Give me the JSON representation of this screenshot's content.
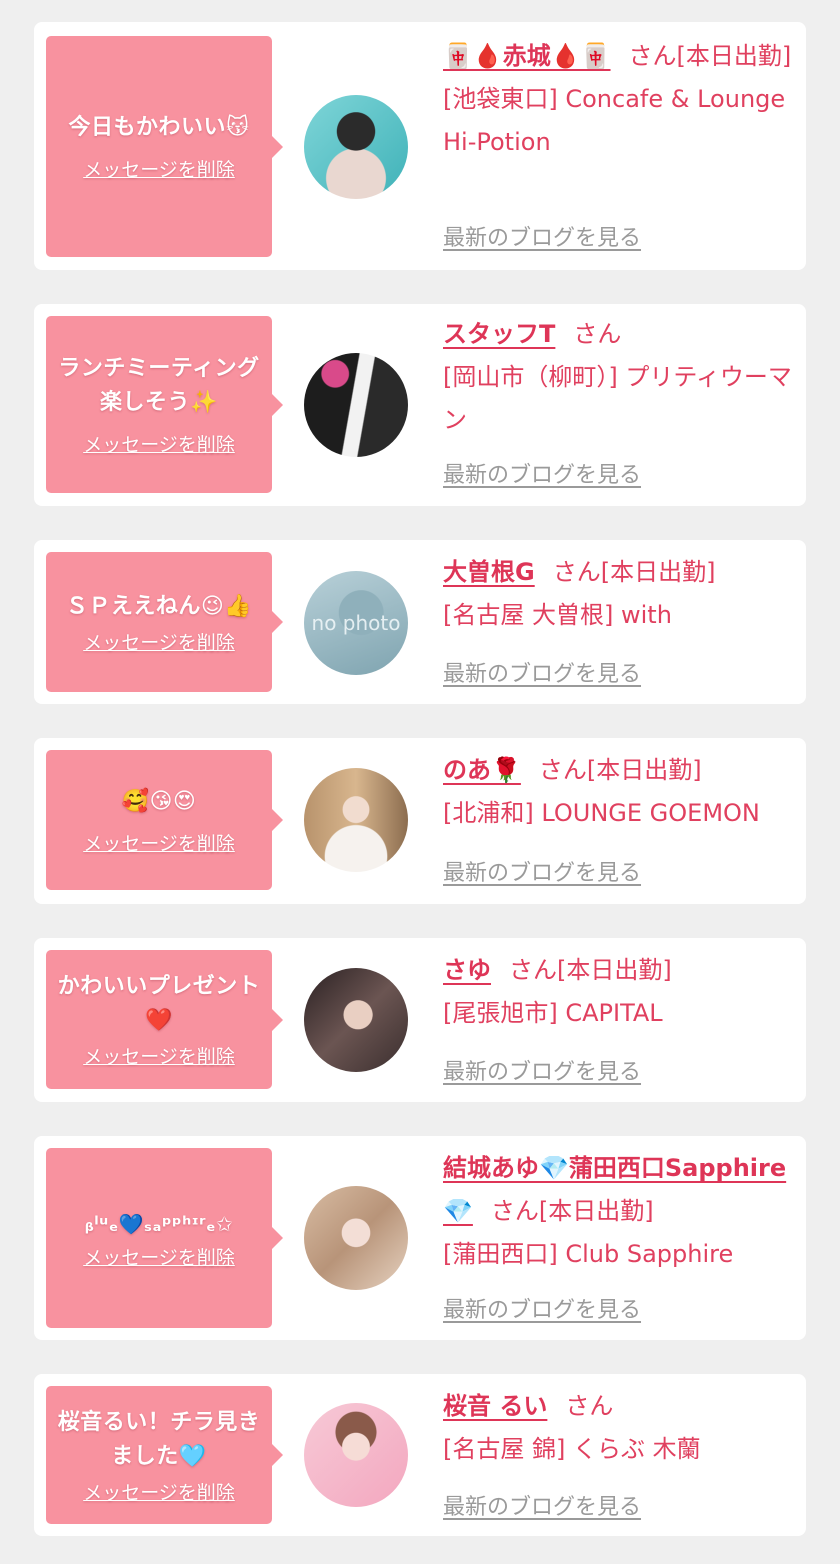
{
  "delete_label": "メッセージを削除",
  "blog_label": "最新のブログを見る",
  "san_label": "さん",
  "colors": {
    "bubble": "#f8929f",
    "accent": "#de3557",
    "link_gray": "#9a9a9a",
    "background": "#efefef"
  },
  "items": [
    {
      "message": "今日もかわいい😽",
      "name": "🀄🩸赤城🩸🀄",
      "status": "[本日出勤]",
      "shop": "[池袋東口] Concafe & Lounge Hi-Potion",
      "avatar": "person-photo"
    },
    {
      "message": "ランチミーティング楽しそう✨",
      "name": "スタッフT",
      "status": "",
      "shop": "[岡山市（柳町）] プリティウーマン",
      "avatar": "shop-logo"
    },
    {
      "message": "ＳＰええねん😉👍",
      "name": "大曽根G",
      "status": "[本日出勤]",
      "shop": "[名古屋 大曽根] with",
      "avatar": "no-photo",
      "avatar_text": "no photo"
    },
    {
      "message": "🥰😘😍",
      "name": "のあ🌹",
      "status": "[本日出勤]",
      "shop": "[北浦和] LOUNGE GOEMON",
      "avatar": "person-photo"
    },
    {
      "message": "かわいいプレゼント❤️",
      "name": "さゆ",
      "status": "[本日出勤]",
      "shop": "[尾張旭市] CAPITAL",
      "avatar": "person-photo"
    },
    {
      "message": "ᵦˡᵘₑ💙ₛₐᵖᵖʰᶦʳₑ✩",
      "name": "結城あゆ💎蒲田西口Sapphire💎",
      "status": "[本日出勤]",
      "shop": "[蒲田西口] Club Sapphire",
      "avatar": "person-photo"
    },
    {
      "message": "桜音るい！チラ見きました🩵",
      "name": "桜音 るい",
      "status": "",
      "shop": "[名古屋 錦] くらぶ 木蘭",
      "avatar": "person-photo"
    }
  ]
}
